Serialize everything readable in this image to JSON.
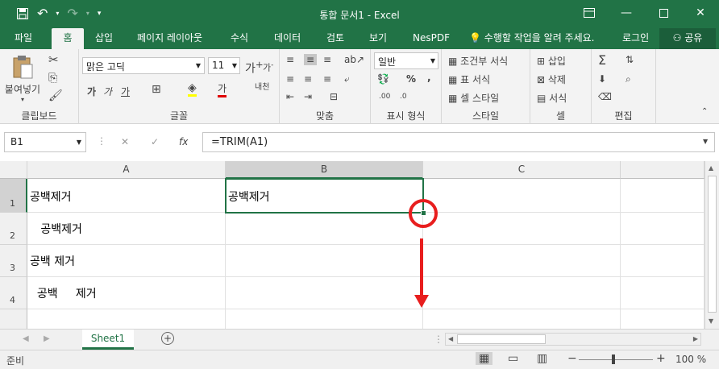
{
  "title": {
    "window_title": "통합 문서1 - Excel"
  },
  "tabs": [
    "파일",
    "홈",
    "삽입",
    "페이지 레이아웃",
    "수식",
    "데이터",
    "검토",
    "보기",
    "NesPDF"
  ],
  "active_tab": "홈",
  "tell_me": "수행할 작업을 알려 주세요.",
  "login": "로그인",
  "share": "공유",
  "ribbon": {
    "clipboard": {
      "paste": "붙여넣기",
      "label": "클립보드"
    },
    "font": {
      "name": "맑은 고딕",
      "size": "11",
      "label": "글꼴",
      "bold": "가",
      "italic": "가",
      "underline": "가",
      "fontcolor": "가",
      "fit": "내천"
    },
    "align": {
      "label": "맞춤"
    },
    "number": {
      "format": "일반",
      "label": "표시 형식"
    },
    "styles": {
      "cond": "조건부 서식",
      "table": "표 서식",
      "cell": "셀 스타일",
      "label": "스타일"
    },
    "cells": {
      "insert": "삽입",
      "delete": "삭제",
      "format": "서식",
      "label": "셀"
    },
    "edit": {
      "label": "편집"
    }
  },
  "formula": {
    "namebox": "B1",
    "fx": "fx",
    "value": "=TRIM(A1)"
  },
  "columns": [
    "A",
    "B",
    "C"
  ],
  "rows": [
    {
      "num": "1",
      "A": "공백제거",
      "B": "공백제거"
    },
    {
      "num": "2",
      "A": "   공백제거",
      "B": ""
    },
    {
      "num": "3",
      "A": "공백 제거",
      "B": ""
    },
    {
      "num": "4",
      "A": "  공백     제거",
      "B": ""
    }
  ],
  "sheet": {
    "tab": "Sheet1"
  },
  "status": {
    "ready": "준비",
    "zoom": "100 %"
  },
  "colors": {
    "accent": "#217346",
    "annotation": "#e81e1e"
  }
}
